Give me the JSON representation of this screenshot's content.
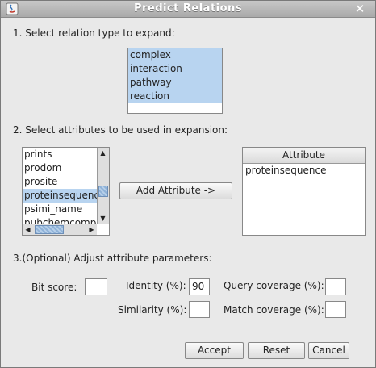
{
  "window": {
    "title": "Predict Relations"
  },
  "step1": {
    "label": "1. Select relation type to expand:",
    "items": [
      "complex",
      "interaction",
      "pathway",
      "reaction"
    ]
  },
  "step2": {
    "label": "2. Select attributes to be used in expansion:",
    "attribute_list": [
      "prints",
      "prodom",
      "prosite",
      "proteinsequence",
      "psimi_name",
      "pubchemcomp"
    ],
    "selected_attribute": "proteinsequence",
    "add_button": "Add Attribute ->",
    "table_header": "Attribute",
    "table_rows": [
      "proteinsequence"
    ]
  },
  "step3": {
    "label": "3.(Optional) Adjust attribute parameters:",
    "bit_score": {
      "label": "Bit score:",
      "value": ""
    },
    "identity": {
      "label": "Identity (%):",
      "value": "90"
    },
    "similarity": {
      "label": "Similarity (%):",
      "value": ""
    },
    "query_coverage": {
      "label": "Query coverage (%):",
      "value": ""
    },
    "match_coverage": {
      "label": "Match coverage (%):",
      "value": ""
    }
  },
  "buttons": {
    "accept": "Accept",
    "reset": "Reset",
    "cancel": "Cancel"
  }
}
